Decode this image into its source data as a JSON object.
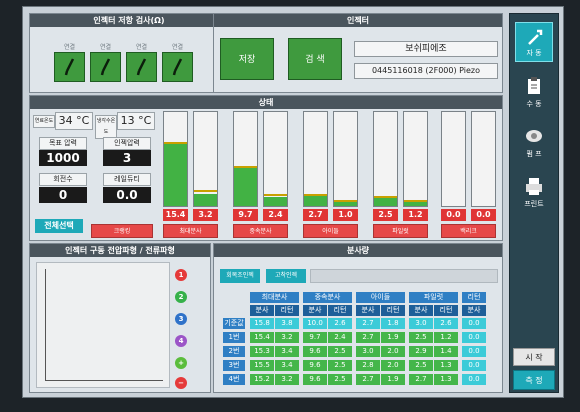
{
  "injector_resistance": {
    "title": "인젝터 저항 검사(Ω)",
    "buttons": [
      "연결",
      "연결",
      "연결",
      "연결"
    ]
  },
  "injector": {
    "title": "인젝터",
    "save_label": "저장",
    "search_label": "검 색",
    "name": "보쉬피에조",
    "code": "0445116018 (2F000) Piezo"
  },
  "status": {
    "title": "상태",
    "temp1_label": "연료온도",
    "temp1_value": "34 °C",
    "temp2_label": "냉각수온도",
    "temp2_value": "13 °C",
    "target_pressure_label": "목표 압력",
    "target_pressure_value": "1000",
    "injection_pressure_label": "인젝압력",
    "injection_pressure_value": "3",
    "rpm_label": "회전수",
    "rpm_value": "0",
    "duty_label": "레일듀티",
    "duty_value": "0.0",
    "select_all_label": "전체선택",
    "gauge_values": [
      "15.4",
      "3.2",
      "9.7",
      "2.4",
      "2.7",
      "1.0",
      "2.5",
      "1.2",
      "0.0",
      "0.0"
    ],
    "gauge_fill_pct": [
      68,
      13,
      40,
      10,
      11,
      4,
      10,
      5,
      0,
      0
    ],
    "mode_buttons": [
      "크랭킹",
      "최대분사",
      "중속분사",
      "아이들",
      "파일럿",
      "백리크"
    ]
  },
  "waveform": {
    "title": "인젝터 구동 전압파형 / 전류파형",
    "channels": [
      "1",
      "2",
      "3",
      "4",
      "+",
      "−"
    ]
  },
  "spray": {
    "title": "분사량",
    "tab1": "회복조인젝",
    "tab2": "고착인젝",
    "groups": [
      "최대분사",
      "중속분사",
      "아이들",
      "파일럿",
      "리턴"
    ],
    "sub_headers": [
      "분사",
      "리턴",
      "분사",
      "리턴",
      "분사",
      "리턴",
      "분사",
      "리턴",
      "분사"
    ],
    "rows": [
      {
        "label": "기준값",
        "values": [
          "15.8",
          "3.8",
          "10.0",
          "2.6",
          "2.7",
          "1.8",
          "3.0",
          "2.6",
          "0.0"
        ]
      },
      {
        "label": "1번",
        "values": [
          "15.4",
          "3.2",
          "9.7",
          "2.4",
          "2.7",
          "1.9",
          "2.5",
          "1.2",
          "0.0"
        ]
      },
      {
        "label": "2번",
        "values": [
          "15.3",
          "3.4",
          "9.6",
          "2.5",
          "3.0",
          "2.0",
          "2.9",
          "1.4",
          "0.0"
        ]
      },
      {
        "label": "3번",
        "values": [
          "15.5",
          "3.4",
          "9.6",
          "2.5",
          "2.8",
          "2.0",
          "2.5",
          "1.3",
          "0.0"
        ]
      },
      {
        "label": "4번",
        "values": [
          "15.2",
          "3.2",
          "9.6",
          "2.5",
          "2.7",
          "1.9",
          "2.7",
          "1.3",
          "0.0"
        ]
      }
    ]
  },
  "sidebar": {
    "buttons": [
      "자 동",
      "수 동",
      "펌 프",
      "프린트"
    ]
  },
  "bottom": {
    "start_label": "시 작",
    "measure_label": "측 정"
  },
  "colors": {
    "green": "#42b244",
    "red": "#e03535",
    "teal": "#1ea9b8",
    "blue": "#2f7fc4"
  }
}
